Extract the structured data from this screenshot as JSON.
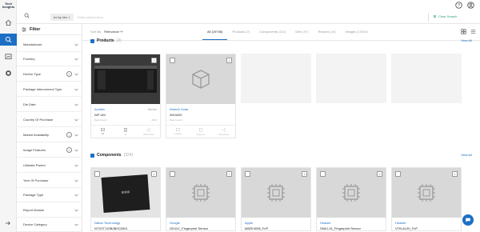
{
  "app": {
    "logo_line1": "Tech",
    "logo_line2": "Insights"
  },
  "search": {
    "chip": "icr by hex",
    "placeholder": "Enter search term",
    "clear_label": "Clear Search"
  },
  "filters": {
    "title": "Filter",
    "items": [
      "Manufacturer",
      "Foundry",
      "Device Type",
      "Package Interconnect Type",
      "Die Date",
      "Country Of Purchase",
      "Market Availability",
      "Image Features",
      "Ultimate Parent",
      "Year Of Purchase",
      "Package Type",
      "Report Module",
      "Device Category"
    ]
  },
  "sort": {
    "label": "Sort By:",
    "value": "Relevance"
  },
  "tabs": [
    {
      "label": "All",
      "count": "(19706)"
    },
    {
      "label": "Products",
      "count": "(2)"
    },
    {
      "label": "Components",
      "count": "(324)"
    },
    {
      "label": "Dies",
      "count": "(97)"
    },
    {
      "label": "Reports",
      "count": "(18)"
    },
    {
      "label": "Images",
      "count": "(19265)"
    }
  ],
  "products": {
    "title": "Products",
    "count": "(2)",
    "view_all": "View All",
    "cards": [
      {
        "manufacturer": "Avnetix",
        "extra": "Senior",
        "part": "WP UM",
        "meta_left": "Date Found",
        "meta_right": "2016",
        "images": "16",
        "reports": "1",
        "third": "Subscribe"
      },
      {
        "manufacturer": "Wuerth Solar",
        "extra": "",
        "part": "WX4020",
        "meta_left": "Date Found",
        "meta_right": "",
        "images": "Images",
        "reports": "Reports",
        "third": "Subscribe"
      }
    ]
  },
  "components": {
    "title": "Components",
    "count": "(324)",
    "view_all": "View All",
    "cards": [
      {
        "manufacturer": "Nahar Technology",
        "part": "NT2GT120B2B0CDBJI"
      },
      {
        "manufacturer": "Google",
        "part": "GD11C_Fingerprint Sensor"
      },
      {
        "manufacturer": "Apple",
        "part": "M8ZE4098_FnP"
      },
      {
        "manufacturer": "Huawei",
        "part": "SN8-L31_Fingerprint Sensor"
      },
      {
        "manufacturer": "Huawei",
        "part": "VTB-AL00_FnP"
      }
    ]
  },
  "colors": {
    "accent": "#1c6fc5",
    "clear": "#2e9e6a"
  }
}
